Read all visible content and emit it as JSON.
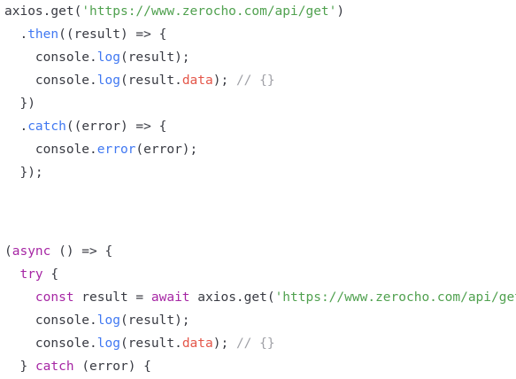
{
  "code": {
    "lines": [
      {
        "indent": "",
        "tokens": [
          {
            "text": "axios.get(",
            "kind": "plain"
          },
          {
            "text": "'https://www.zerocho.com/api/get'",
            "kind": "string"
          },
          {
            "text": ")",
            "kind": "plain"
          }
        ]
      },
      {
        "indent": "  ",
        "tokens": [
          {
            "text": ".",
            "kind": "plain"
          },
          {
            "text": "then",
            "kind": "method"
          },
          {
            "text": "((result) => {",
            "kind": "plain"
          }
        ]
      },
      {
        "indent": "    ",
        "tokens": [
          {
            "text": "console.",
            "kind": "plain"
          },
          {
            "text": "log",
            "kind": "method"
          },
          {
            "text": "(result);",
            "kind": "plain"
          }
        ]
      },
      {
        "indent": "    ",
        "tokens": [
          {
            "text": "console.",
            "kind": "plain"
          },
          {
            "text": "log",
            "kind": "method"
          },
          {
            "text": "(result.",
            "kind": "plain"
          },
          {
            "text": "data",
            "kind": "prop"
          },
          {
            "text": "); ",
            "kind": "plain"
          },
          {
            "text": "// {}",
            "kind": "comment"
          }
        ]
      },
      {
        "indent": "  ",
        "tokens": [
          {
            "text": "})",
            "kind": "plain"
          }
        ]
      },
      {
        "indent": "  ",
        "tokens": [
          {
            "text": ".",
            "kind": "plain"
          },
          {
            "text": "catch",
            "kind": "method"
          },
          {
            "text": "((error) => {",
            "kind": "plain"
          }
        ]
      },
      {
        "indent": "    ",
        "tokens": [
          {
            "text": "console.",
            "kind": "plain"
          },
          {
            "text": "error",
            "kind": "method"
          },
          {
            "text": "(error);",
            "kind": "plain"
          }
        ]
      },
      {
        "indent": "  ",
        "tokens": [
          {
            "text": "});",
            "kind": "plain"
          }
        ]
      },
      {
        "indent": "",
        "tokens": []
      },
      {
        "indent": "",
        "tokens": []
      },
      {
        "indent": "",
        "tokens": [
          {
            "text": "(",
            "kind": "plain"
          },
          {
            "text": "async",
            "kind": "keyword"
          },
          {
            "text": " () => {",
            "kind": "plain"
          }
        ]
      },
      {
        "indent": "  ",
        "tokens": [
          {
            "text": "try",
            "kind": "keyword"
          },
          {
            "text": " {",
            "kind": "plain"
          }
        ]
      },
      {
        "indent": "    ",
        "tokens": [
          {
            "text": "const",
            "kind": "keyword"
          },
          {
            "text": " result = ",
            "kind": "plain"
          },
          {
            "text": "await",
            "kind": "keyword"
          },
          {
            "text": " axios.get(",
            "kind": "plain"
          },
          {
            "text": "'https://www.zerocho.com/api/get'",
            "kind": "string"
          },
          {
            "text": ");",
            "kind": "plain"
          }
        ]
      },
      {
        "indent": "    ",
        "tokens": [
          {
            "text": "console.",
            "kind": "plain"
          },
          {
            "text": "log",
            "kind": "method"
          },
          {
            "text": "(result);",
            "kind": "plain"
          }
        ]
      },
      {
        "indent": "    ",
        "tokens": [
          {
            "text": "console.",
            "kind": "plain"
          },
          {
            "text": "log",
            "kind": "method"
          },
          {
            "text": "(result.",
            "kind": "plain"
          },
          {
            "text": "data",
            "kind": "prop"
          },
          {
            "text": "); ",
            "kind": "plain"
          },
          {
            "text": "// {}",
            "kind": "comment"
          }
        ]
      },
      {
        "indent": "  ",
        "tokens": [
          {
            "text": "} ",
            "kind": "plain"
          },
          {
            "text": "catch",
            "kind": "keyword"
          },
          {
            "text": " (error) {",
            "kind": "plain"
          }
        ]
      }
    ]
  },
  "colors": {
    "background": "#ffffff",
    "plain": "#383a42",
    "method": "#4078f2",
    "string": "#50a14f",
    "property": "#e45649",
    "comment": "#a0a1a7",
    "keyword": "#a626a4"
  }
}
